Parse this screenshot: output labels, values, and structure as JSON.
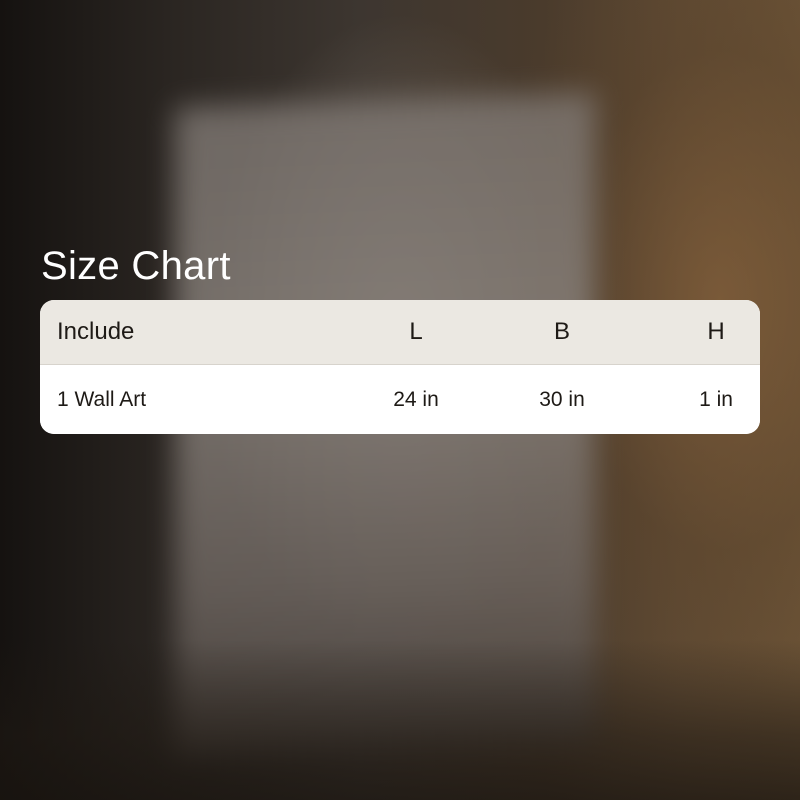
{
  "title": "Size Chart",
  "table": {
    "headers": {
      "include": "Include",
      "l": "L",
      "b": "B",
      "h": "H"
    },
    "rows": [
      {
        "include": "1 Wall Art",
        "l": "24 in",
        "b": "30 in",
        "h": "1 in"
      }
    ]
  }
}
